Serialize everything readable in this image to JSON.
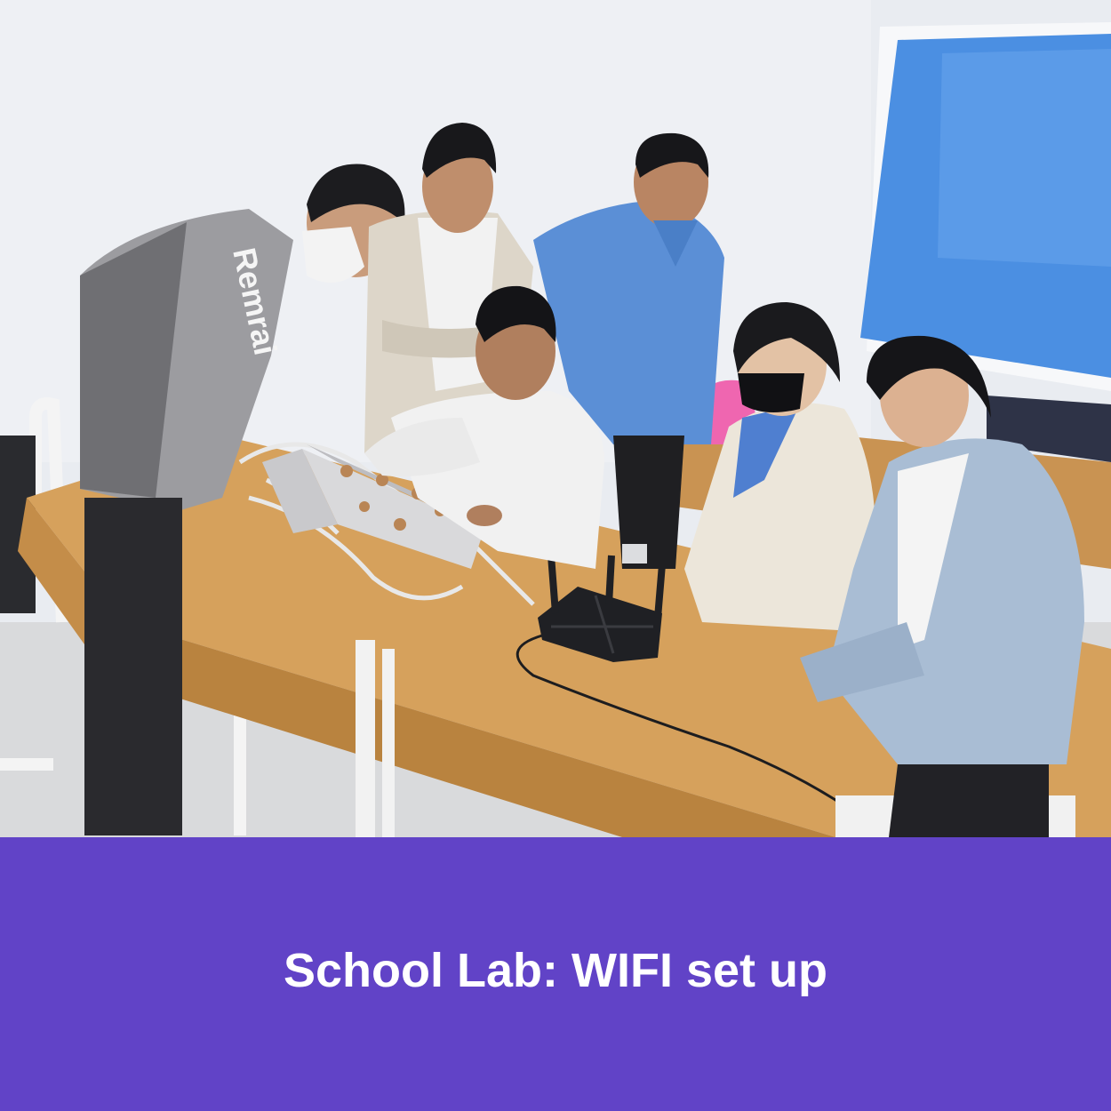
{
  "photo": {
    "subject": "school-lab-wifi-setup-photo",
    "jacket_text": "Remrai"
  },
  "caption": {
    "text": "School Lab: WIFI set up"
  },
  "colors": {
    "band": "#6143c7",
    "caption_text": "#ffffff",
    "wall": "#e9ecf1",
    "window_blind": "#4b8fe2",
    "desk_wood": "#d6a15c",
    "blue_shirt": "#5b8fd6"
  }
}
